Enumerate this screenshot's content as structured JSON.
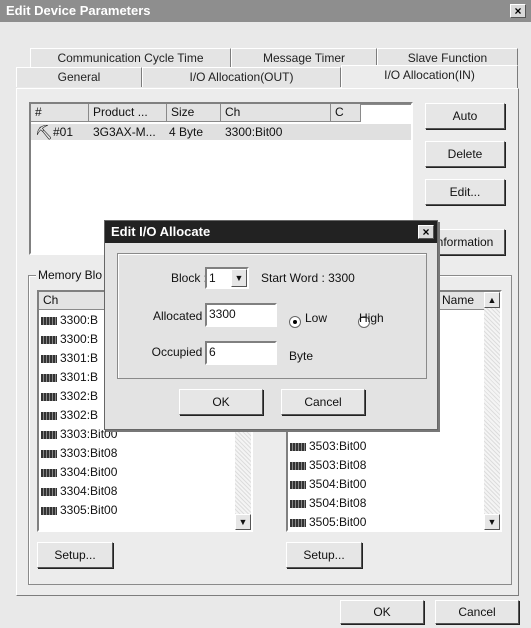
{
  "window": {
    "title": "Edit Device Parameters",
    "close": "×"
  },
  "tabs_row1": [
    "Communication Cycle Time",
    "Message Timer",
    "Slave Function"
  ],
  "tabs_row2": [
    "General",
    "I/O Allocation(OUT)",
    "I/O Allocation(IN)"
  ],
  "device_list": {
    "headers": [
      "#",
      "Product ...",
      "Size",
      "Ch",
      "C"
    ],
    "rows": [
      {
        "num": "#01",
        "product": "3G3AX-M...",
        "size": "4 Byte",
        "ch": "3300:Bit00"
      }
    ]
  },
  "side_buttons": {
    "auto": "Auto",
    "delete": "Delete",
    "edit": "Edit...",
    "information": "nformation"
  },
  "memory_block": {
    "label": "Memory Blo",
    "left_header": "Ch",
    "right_header": "Name",
    "left_rows": [
      "3300:B",
      "3300:B",
      "3301:B",
      "3301:B",
      "3302:B",
      "3302:B",
      "3303:Bit00",
      "3303:Bit08",
      "3304:Bit00",
      "3304:Bit08",
      "3305:Bit00"
    ],
    "right_rows": [
      "3503:Bit00",
      "3503:Bit08",
      "3504:Bit00",
      "3504:Bit08",
      "3505:Bit00"
    ],
    "setup": "Setup...",
    "setup2": "Setup..."
  },
  "footer": {
    "ok": "OK",
    "cancel": "Cancel"
  },
  "dialog": {
    "title": "Edit I/O Allocate",
    "close": "×",
    "block_label": "Block :",
    "block_value": "1",
    "start_word": "Start Word : 3300",
    "allocated_label": "Allocated :",
    "allocated_value": "3300",
    "low": "Low",
    "high": "High",
    "occupied_label": "Occupied :",
    "occupied_value": "6",
    "byte": "Byte",
    "ok": "OK",
    "cancel": "Cancel"
  }
}
